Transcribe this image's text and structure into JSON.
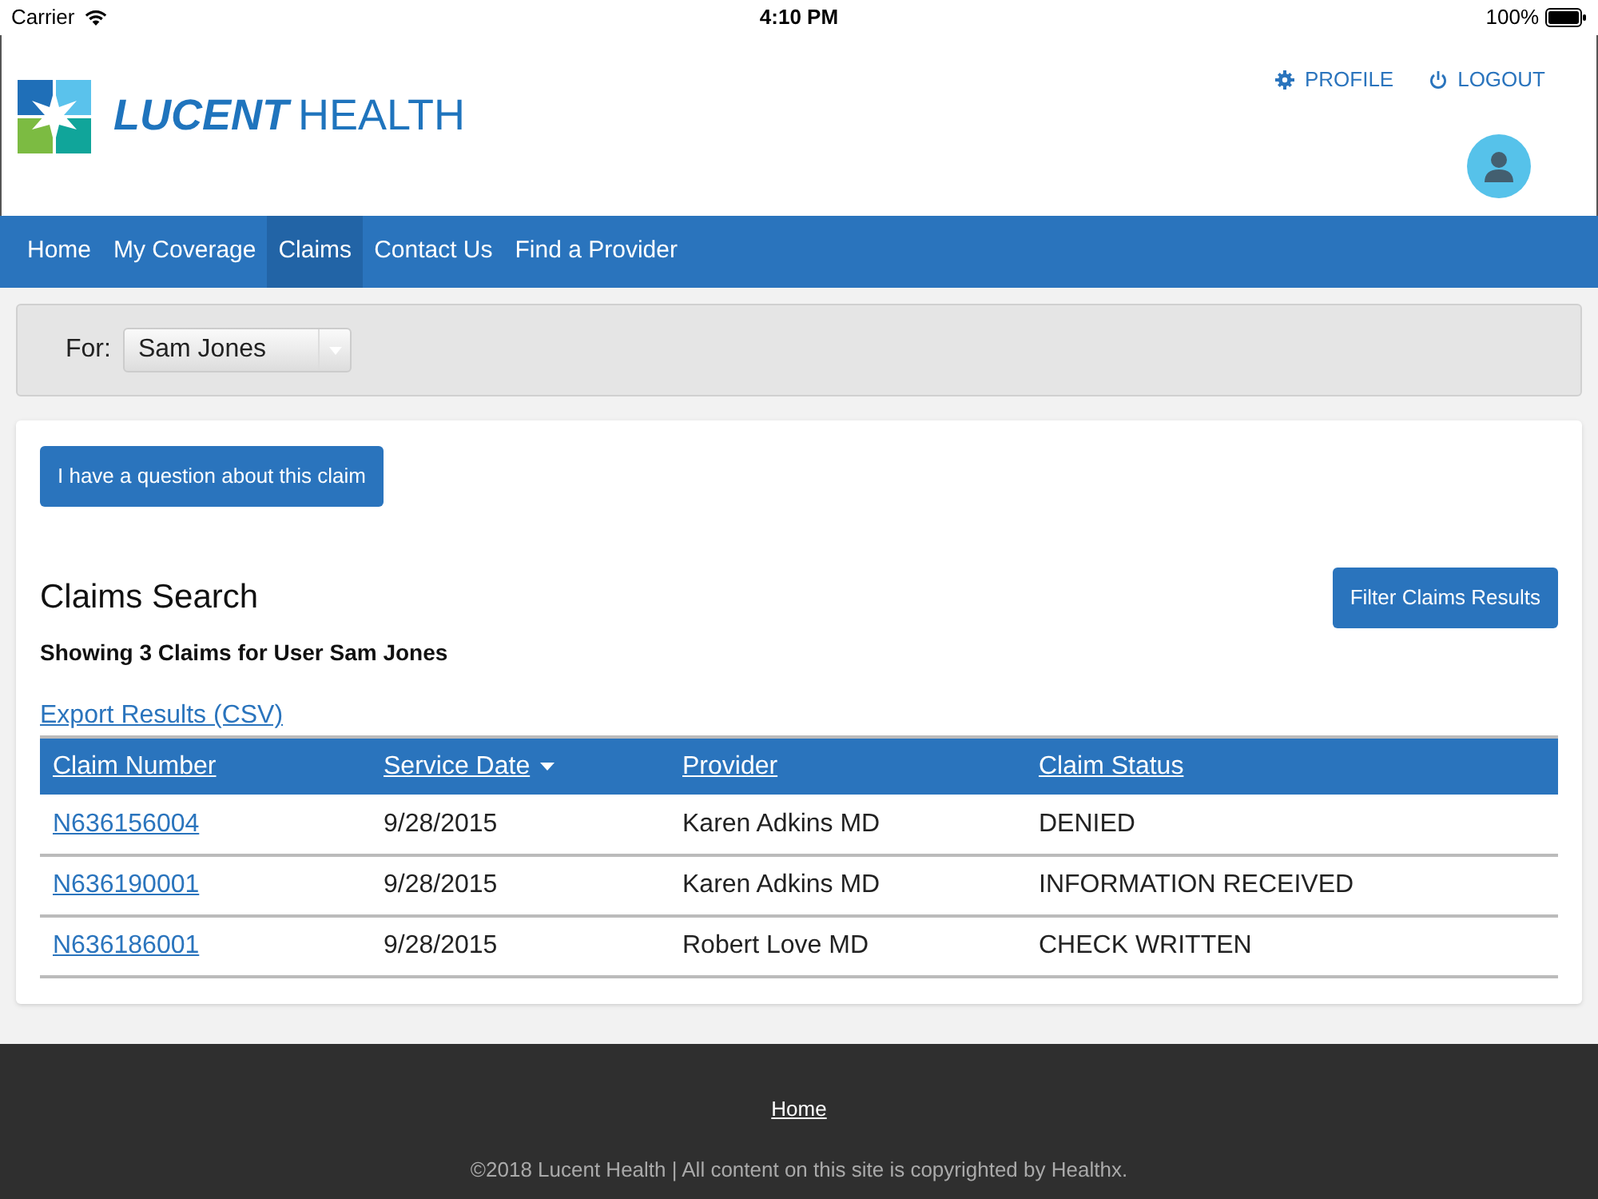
{
  "status_bar": {
    "carrier": "Carrier",
    "time": "4:10 PM",
    "battery": "100%"
  },
  "logo": {
    "brand": "LUCENT",
    "suffix": "HEALTH"
  },
  "header_links": [
    {
      "kind": "profile",
      "label": "PROFILE"
    },
    {
      "kind": "logout",
      "label": "LOGOUT"
    }
  ],
  "nav": [
    {
      "label": "Home",
      "selected": false
    },
    {
      "label": "My Coverage",
      "selected": false
    },
    {
      "label": "Claims",
      "selected": true
    },
    {
      "label": "Contact Us",
      "selected": false
    },
    {
      "label": "Find a Provider",
      "selected": false
    }
  ],
  "member_filter": {
    "label": "For:",
    "value": "Sam Jones"
  },
  "question_button": "I have a question about this claim",
  "title": "Claims Search",
  "filter_button": "Filter Claims Results",
  "summary": "Showing 3 Claims for User Sam Jones",
  "export_link": "Export Results (CSV)",
  "table": {
    "columns": [
      {
        "label": "Claim Number",
        "sorted": false
      },
      {
        "label": "Service Date",
        "sorted": true
      },
      {
        "label": "Provider",
        "sorted": false
      },
      {
        "label": "Claim Status",
        "sorted": false
      }
    ],
    "rows": [
      [
        "N636156004",
        "9/28/2015",
        "Karen Adkins MD",
        "DENIED"
      ],
      [
        "N636190001",
        "9/28/2015",
        "Karen Adkins MD",
        "INFORMATION RECEIVED"
      ],
      [
        "N636186001",
        "9/28/2015",
        "Robert Love MD",
        "CHECK WRITTEN"
      ]
    ]
  },
  "footer": {
    "link": "Home",
    "copyright": "©2018 Lucent Health | All content on this site is copyrighted by Healthx."
  }
}
